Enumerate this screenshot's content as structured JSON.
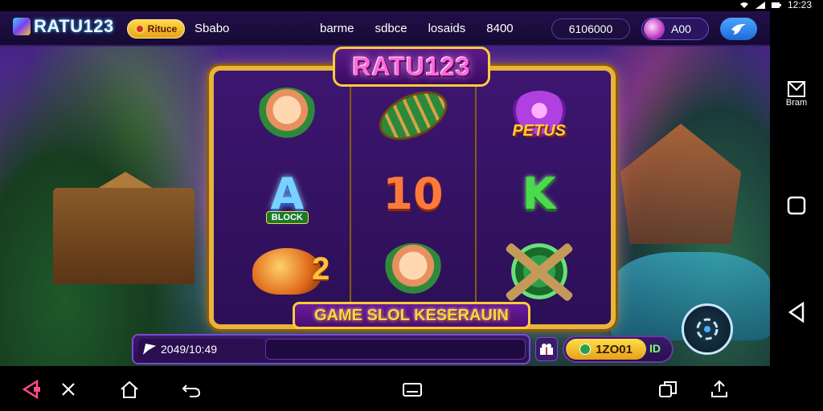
{
  "statusbar": {
    "time": "12:23"
  },
  "header": {
    "brand": "RATU123",
    "promo_label": "Rituce",
    "nav_first": "Sbabo",
    "nav": [
      "barme",
      "sdbce",
      "losaids",
      "8400"
    ],
    "balance": "6106000",
    "avatar_value": "A00"
  },
  "slot": {
    "title": "RATU123",
    "bonus_text": "PETUS",
    "a_tag": "BLOCK",
    "banner": "GAME SLOL KESERAUIN"
  },
  "controls": {
    "bet_text": "2049/10:49",
    "spin_amount": "1ZO01",
    "spin_code": "ID"
  },
  "right_nav": {
    "label": "Bram"
  },
  "icons": {
    "logo": "logo-cube-icon",
    "share": "bird-icon",
    "gift": "gift-icon",
    "auto": "auto-spin-icon"
  },
  "colors": {
    "accent": "#e8b43a",
    "brand": "#7b3ff2",
    "spin": "#ffdf4a"
  }
}
